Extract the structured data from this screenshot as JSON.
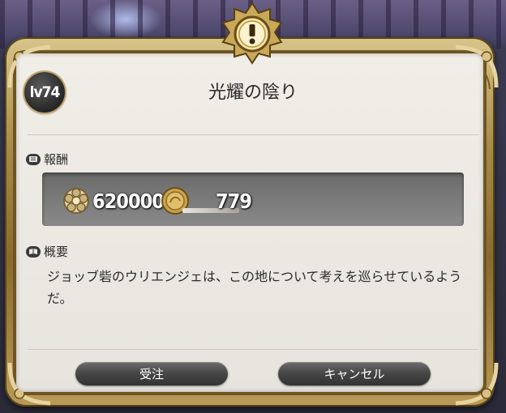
{
  "quest": {
    "level": "lv74",
    "title": "光耀の陰り",
    "rewards_label": "報酬",
    "rewards": [
      {
        "icon": "gil-icon",
        "amount": "620000"
      },
      {
        "icon": "allagan-tomestone-icon",
        "amount": "779"
      }
    ],
    "summary_label": "概要",
    "summary": "ジョッブ砦のウリエンジェは、この地について考えを巡らせているようだ。"
  },
  "buttons": {
    "accept": "受注",
    "cancel": "キャンセル"
  },
  "colors": {
    "frame_gold": "#b99a58",
    "panel": "#efece6",
    "button": "#444444"
  }
}
